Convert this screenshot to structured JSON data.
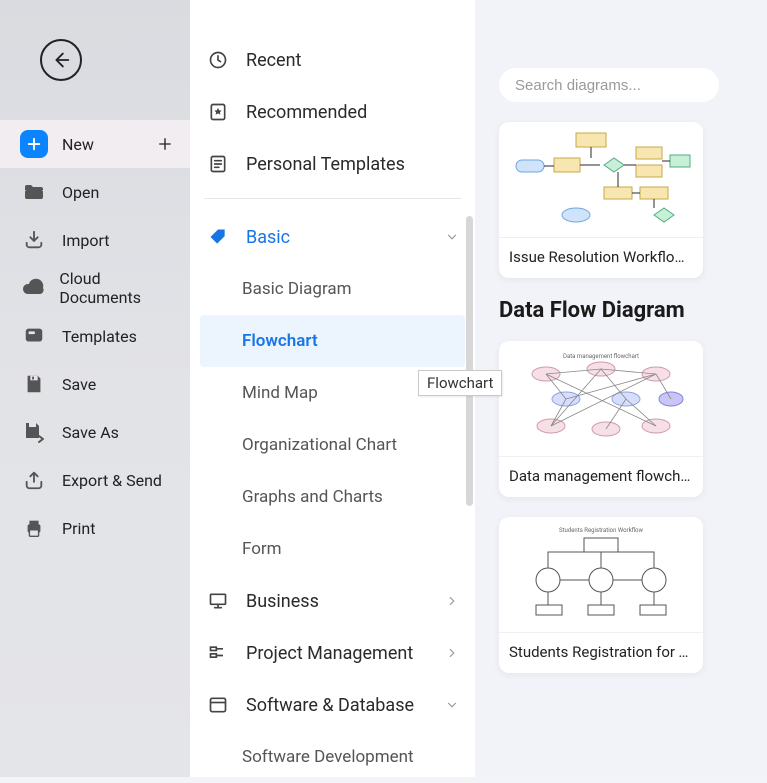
{
  "sidebar": {
    "items": [
      {
        "label": "New",
        "icon": "plus-box",
        "active": true,
        "trailing_plus": true
      },
      {
        "label": "Open",
        "icon": "folder",
        "active": false
      },
      {
        "label": "Import",
        "icon": "import",
        "active": false
      },
      {
        "label": "Cloud Documents",
        "icon": "cloud",
        "active": false
      },
      {
        "label": "Templates",
        "icon": "templates",
        "active": false
      },
      {
        "label": "Save",
        "icon": "save",
        "active": false
      },
      {
        "label": "Save As",
        "icon": "save-as",
        "active": false
      },
      {
        "label": "Export & Send",
        "icon": "export",
        "active": false
      },
      {
        "label": "Print",
        "icon": "print",
        "active": false
      }
    ]
  },
  "categories": {
    "top": [
      {
        "label": "Recent",
        "icon": "clock"
      },
      {
        "label": "Recommended",
        "icon": "star-badge"
      },
      {
        "label": "Personal Templates",
        "icon": "personal-tpl"
      }
    ],
    "groups": [
      {
        "label": "Basic",
        "icon": "tag",
        "expanded": true,
        "children": [
          {
            "label": "Basic Diagram"
          },
          {
            "label": "Flowchart",
            "selected": true
          },
          {
            "label": "Mind Map"
          },
          {
            "label": "Organizational Chart"
          },
          {
            "label": "Graphs and Charts"
          },
          {
            "label": "Form"
          }
        ]
      },
      {
        "label": "Business",
        "icon": "presentation",
        "expanded": false
      },
      {
        "label": "Project Management",
        "icon": "pm",
        "expanded": false
      },
      {
        "label": "Software & Database",
        "icon": "window",
        "expanded": false,
        "children": [
          {
            "label": "Software Development"
          }
        ]
      }
    ]
  },
  "tooltip": "Flowchart",
  "search": {
    "placeholder": "Search diagrams..."
  },
  "content": {
    "cards_before_section": [
      {
        "label": "Issue Resolution Workflow ..."
      }
    ],
    "section_title": "Data Flow Diagram",
    "section_cards": [
      {
        "label": "Data management flowchart"
      },
      {
        "label": "Students Registration for T..."
      }
    ]
  },
  "colors": {
    "accent": "#1776e6",
    "sidebar_active_bg": "#f2edf1",
    "plus_box_bg": "#0a84ff"
  }
}
